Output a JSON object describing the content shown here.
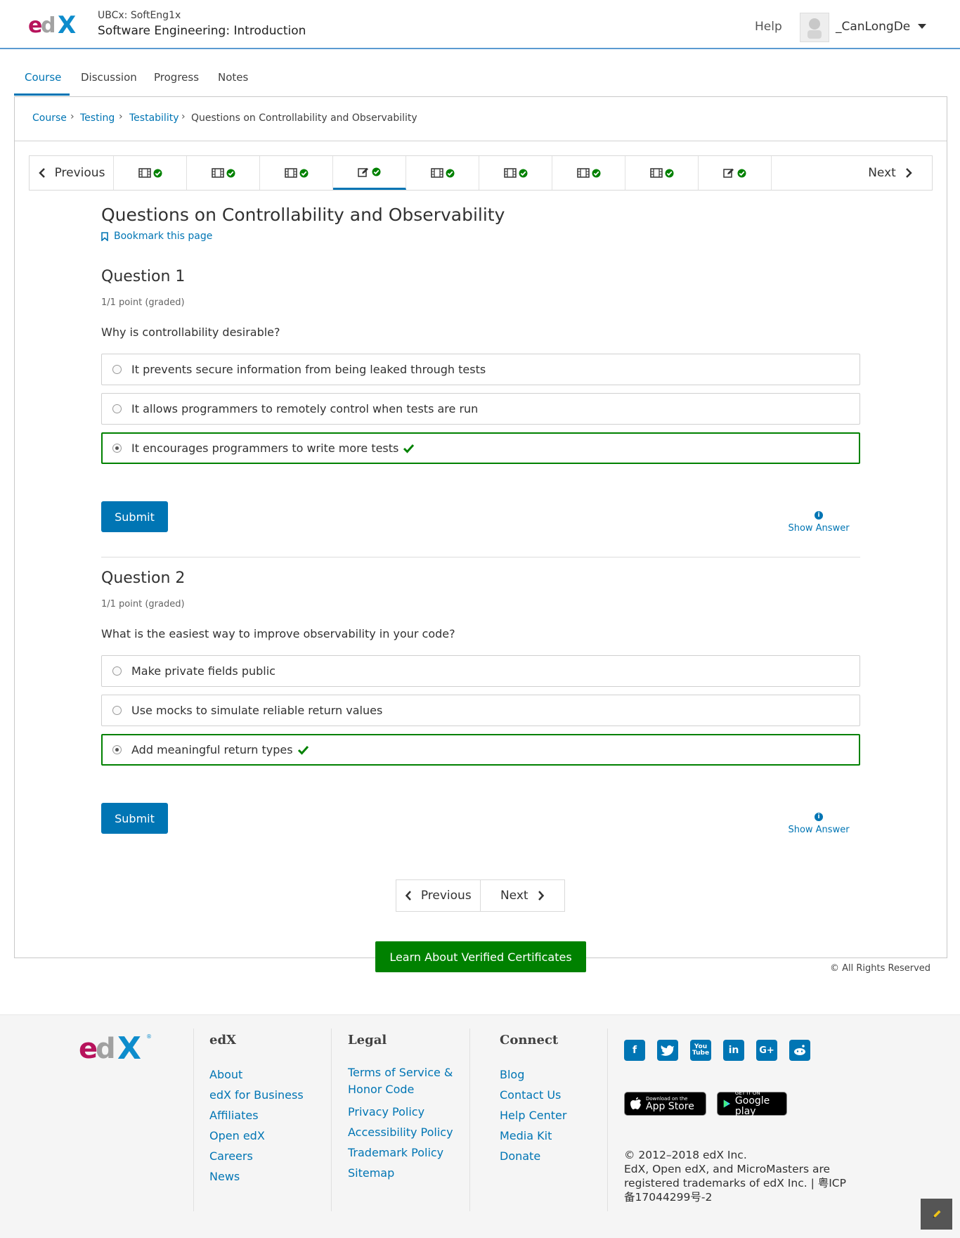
{
  "header": {
    "org_course": "UBCx: SoftEng1x",
    "course_title": "Software Engineering: Introduction",
    "help_label": "Help",
    "username": "_CanLongDe"
  },
  "tabs": [
    "Course",
    "Discussion",
    "Progress",
    "Notes"
  ],
  "breadcrumb": [
    "Course",
    "Testing",
    "Testability",
    "Questions on Controllability and Observability"
  ],
  "sequence": {
    "previous_label": "Previous",
    "next_label": "Next",
    "items": [
      "video",
      "video",
      "video",
      "problem",
      "video",
      "video",
      "video",
      "video",
      "problem"
    ],
    "active_index": 3
  },
  "unit": {
    "title": "Questions on Controllability and Observability",
    "bookmark_label": "Bookmark this page"
  },
  "questions": [
    {
      "title": "Question 1",
      "meta": "1/1 point (graded)",
      "prompt": "Why is controllability desirable?",
      "choices": [
        "It prevents secure information from being leaked through tests",
        "It allows programmers to remotely control when tests are run",
        "It encourages programmers to write more tests"
      ],
      "selected": 2,
      "submit_label": "Submit",
      "show_answer_label": "Show Answer"
    },
    {
      "title": "Question 2",
      "meta": "1/1 point (graded)",
      "prompt": "What is the easiest way to improve observability in your code?",
      "choices": [
        "Make private fields public",
        "Use mocks to simulate reliable return values",
        "Add meaningful return types"
      ],
      "selected": 2,
      "submit_label": "Submit",
      "show_answer_label": "Show Answer"
    }
  ],
  "bottom_nav": {
    "previous_label": "Previous",
    "next_label": "Next"
  },
  "verified_button": "Learn About Verified Certificates",
  "rights": "© All Rights Reserved",
  "footer": {
    "edx": {
      "heading": "edX",
      "links": [
        "About",
        "edX for Business",
        "Affiliates",
        "Open edX",
        "Careers",
        "News"
      ]
    },
    "legal": {
      "heading": "Legal",
      "links": [
        "Terms of Service &",
        "Honor Code",
        "Privacy Policy",
        "Accessibility Policy",
        "Trademark Policy",
        "Sitemap"
      ]
    },
    "connect": {
      "heading": "Connect",
      "links": [
        "Blog",
        "Contact Us",
        "Help Center",
        "Media Kit",
        "Donate"
      ]
    },
    "social": [
      "facebook-icon",
      "twitter-icon",
      "youtube-icon",
      "linkedin-icon",
      "google-plus-icon",
      "reddit-icon"
    ],
    "appstore": {
      "small": "Download on the",
      "big": "App Store"
    },
    "googleplay": {
      "small": "GET IT ON",
      "big": "Google play"
    },
    "copyright_line1": "© 2012–2018 edX Inc.",
    "copyright_line2": "EdX, Open edX, and MicroMasters are registered trademarks of edX Inc. | 粤ICP备17044299号-2"
  },
  "colors": {
    "accent": "#0075b4",
    "correct": "#008100",
    "brand_pink": "#b7135c"
  }
}
